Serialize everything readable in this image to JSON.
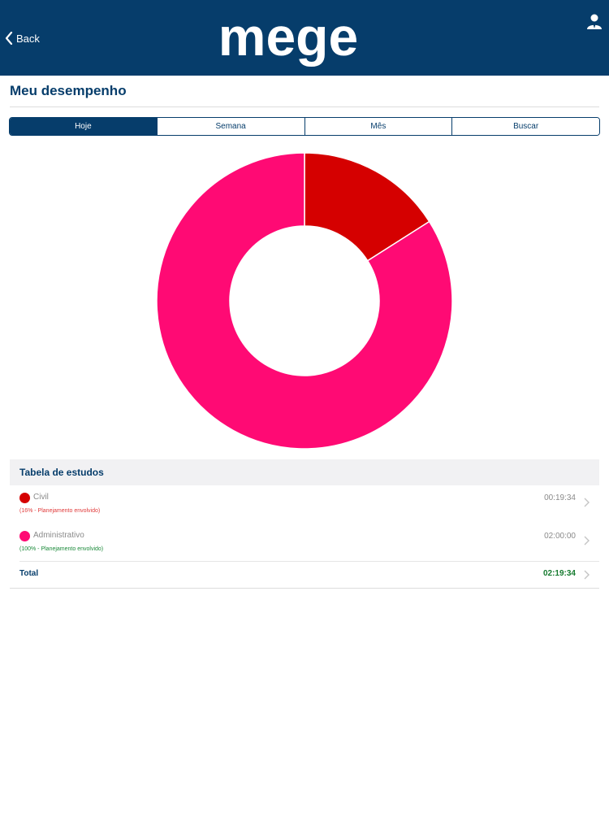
{
  "header": {
    "back_label": "Back",
    "logo_text": "mege",
    "bg_color": "#063d6b"
  },
  "page": {
    "title": "Meu desempenho"
  },
  "tabs": [
    {
      "label": "Hoje",
      "active": true
    },
    {
      "label": "Semana",
      "active": false
    },
    {
      "label": "Mês",
      "active": false
    },
    {
      "label": "Buscar",
      "active": false
    }
  ],
  "chart_data": {
    "type": "pie",
    "donut": true,
    "labels": [
      "Civil",
      "Administrativo"
    ],
    "values": [
      16,
      84
    ],
    "colors": [
      "#d50000",
      "#ff0a74"
    ]
  },
  "table": {
    "title": "Tabela de estudos",
    "rows": [
      {
        "name": "Civil",
        "sub": "(16% - Planejamento envolvido)",
        "time": "00:19:34",
        "color": "#d50000",
        "sub_color": "#e03a3a"
      },
      {
        "name": "Administrativo",
        "sub": "(100% - Planejamento envolvido)",
        "time": "02:00:00",
        "color": "#ff0a74",
        "sub_color": "#1b8a3a"
      }
    ],
    "total_label": "Total",
    "total_time": "02:19:34"
  }
}
